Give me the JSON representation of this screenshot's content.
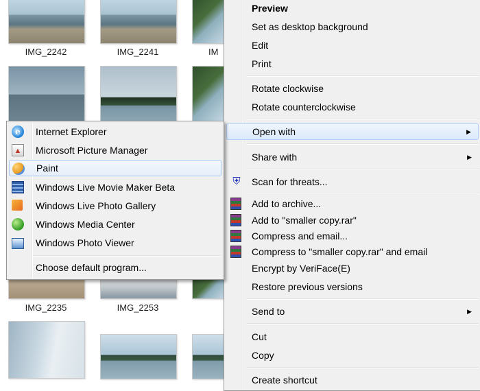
{
  "thumbnails": [
    {
      "caption": "IMG_2242"
    },
    {
      "caption": "IMG_2241"
    },
    {
      "caption": "IMG_2235"
    },
    {
      "caption": "IMG_2253"
    }
  ],
  "partial_caption": "IM",
  "context_menu": {
    "items": [
      {
        "label": "Preview"
      },
      {
        "label": "Set as desktop background"
      },
      {
        "label": "Edit"
      },
      {
        "label": "Print"
      },
      {
        "label": "Rotate clockwise"
      },
      {
        "label": "Rotate counterclockwise"
      },
      {
        "label": "Open with"
      },
      {
        "label": "Share with"
      },
      {
        "label": "Scan for threats..."
      },
      {
        "label": "Add to archive..."
      },
      {
        "label": "Add to \"smaller copy.rar\""
      },
      {
        "label": "Compress and email..."
      },
      {
        "label": "Compress to \"smaller copy.rar\" and email"
      },
      {
        "label": "Encrypt by VeriFace(E)"
      },
      {
        "label": "Restore previous versions"
      },
      {
        "label": "Send to"
      },
      {
        "label": "Cut"
      },
      {
        "label": "Copy"
      },
      {
        "label": "Create shortcut"
      }
    ]
  },
  "open_with_submenu": {
    "items": [
      {
        "label": "Internet Explorer",
        "icon": "internet-explorer-icon"
      },
      {
        "label": "Microsoft Picture Manager",
        "icon": "picture-manager-icon"
      },
      {
        "label": "Paint",
        "icon": "paint-icon"
      },
      {
        "label": "Windows Live Movie Maker Beta",
        "icon": "movie-maker-icon"
      },
      {
        "label": "Windows Live Photo Gallery",
        "icon": "photo-gallery-icon"
      },
      {
        "label": "Windows Media Center",
        "icon": "media-center-icon"
      },
      {
        "label": "Windows Photo Viewer",
        "icon": "photo-viewer-icon"
      },
      {
        "label": "Choose default program..."
      }
    ]
  },
  "colors": {
    "menu_background": "#f0f0f0",
    "highlight_border": "#aecff7",
    "highlight_fill": "#dceafc"
  }
}
